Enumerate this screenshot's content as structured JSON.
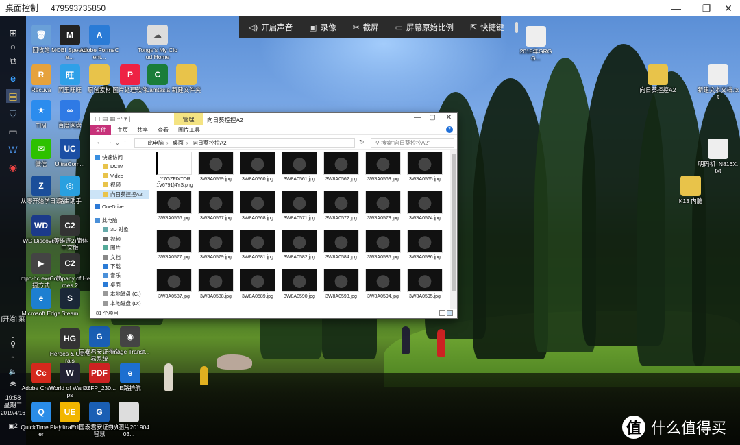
{
  "remote_window": {
    "title": "桌面控制",
    "remote_id": "479593735850",
    "controls": {
      "minimize": "—",
      "restore": "❐",
      "close": "✕"
    }
  },
  "toolbar": {
    "items": [
      {
        "label": "开启声音",
        "icon": "speaker-icon"
      },
      {
        "label": "录像",
        "icon": "record-icon"
      },
      {
        "label": "截屏",
        "icon": "scissors-icon"
      },
      {
        "label": "屏幕原始比例",
        "icon": "ratio-icon"
      },
      {
        "label": "快捷键",
        "icon": "shortcut-icon"
      }
    ]
  },
  "taskbar": {
    "start_label": "[开始] 菜",
    "ime": "英",
    "clock_time": "19:58",
    "clock_day": "星期二",
    "clock_date": "2019/4/16",
    "notification_count": "2"
  },
  "desktop_icons": [
    {
      "label": "回收站",
      "color": "#6aa0d8",
      "glyph": "🗑"
    },
    {
      "label": "MOBI Speedfre...",
      "color": "#222",
      "glyph": "M"
    },
    {
      "label": "Adobe FormsCent...",
      "color": "#2a7bd6",
      "glyph": "A"
    },
    {
      "label": "Tonge's My Cloud Home",
      "color": "#ddd",
      "glyph": "☁"
    },
    {
      "label": "Recuva",
      "color": "#e6a23c",
      "glyph": "R"
    },
    {
      "label": "阿里旺旺",
      "color": "#2fa0e8",
      "glyph": "旺"
    },
    {
      "label": "原创素材",
      "color": "#e8c34a",
      "glyph": ""
    },
    {
      "label": "图片处理软件",
      "color": "#e24",
      "glyph": "P"
    },
    {
      "label": "Camtasia",
      "color": "#1a7d3a",
      "glyph": "C"
    },
    {
      "label": "新建文件夹",
      "color": "#e8c34a",
      "glyph": ""
    },
    {
      "label": "TIM",
      "color": "#2b8cee",
      "glyph": "★"
    },
    {
      "label": "百度网盘",
      "color": "#2f7ae5",
      "glyph": "∞"
    },
    {
      "label": "微信",
      "color": "#2dc100",
      "glyph": "✉"
    },
    {
      "label": "UltraCom...",
      "color": "#1b4fa5",
      "glyph": "UC"
    },
    {
      "label": "从零开始学日语",
      "color": "#1a4e9a",
      "glyph": "Z"
    },
    {
      "label": "路由助手",
      "color": "#29a0e0",
      "glyph": "◎"
    },
    {
      "label": "WD Discovery",
      "color": "#1b3a8a",
      "glyph": "WD"
    },
    {
      "label": "(英雄连2)简体中文版",
      "color": "#333",
      "glyph": "C2"
    },
    {
      "label": "mpc-hc.exe - 快捷方式",
      "color": "#444",
      "glyph": "▶"
    },
    {
      "label": "Company of Heroes 2",
      "color": "#333",
      "glyph": "C2"
    },
    {
      "label": "Microsoft Edge",
      "color": "#1d7fd1",
      "glyph": "e"
    },
    {
      "label": "Steam",
      "color": "#1b2838",
      "glyph": "S"
    },
    {
      "label": "Heroes & Generals",
      "color": "#333",
      "glyph": "HG"
    },
    {
      "label": "国泰君安证券交易系统",
      "color": "#1a5fb4",
      "glyph": "G"
    },
    {
      "label": "Image Transf...",
      "color": "#444",
      "glyph": "◉"
    },
    {
      "label": "Adobe Creati...",
      "color": "#d4291c",
      "glyph": "Cc"
    },
    {
      "label": "World of Warships",
      "color": "#223",
      "glyph": "W"
    },
    {
      "label": "DZFP_230...",
      "color": "#c22",
      "glyph": "PDF"
    },
    {
      "label": "E路护航",
      "color": "#1d6fd0",
      "glyph": "e"
    },
    {
      "label": "QuickTime Player",
      "color": "#2a8de8",
      "glyph": "Q"
    },
    {
      "label": "UltraEdit",
      "color": "#f2b600",
      "glyph": "UE"
    },
    {
      "label": "国泰君安证券大智慧",
      "color": "#1a5fb4",
      "glyph": "G"
    },
    {
      "label": "TIM图片20190403...",
      "color": "#ddd",
      "glyph": ""
    },
    {
      "label": "2018年GRGG...",
      "color": "#eee",
      "glyph": ""
    },
    {
      "label": "向日葵控控A2",
      "color": "#e8c34a",
      "glyph": ""
    },
    {
      "label": "新建文本文档.txt",
      "color": "#eee",
      "glyph": ""
    },
    {
      "label": "明码机_N816X.txt",
      "color": "#eee",
      "glyph": ""
    },
    {
      "label": "K13 内脏",
      "color": "#e8c34a",
      "glyph": ""
    }
  ],
  "explorer": {
    "title": "向日葵控控A2",
    "manage_tab": "管理",
    "ribbon_tabs": [
      "文件",
      "主页",
      "共享",
      "查看",
      "图片工具"
    ],
    "breadcrumb": [
      "此电脑",
      "桌面",
      "向日葵控控A2"
    ],
    "search_placeholder": "搜索\"向日葵控控A2\"",
    "nav_items": [
      {
        "label": "快速访问",
        "kind": "star"
      },
      {
        "label": "DCIM",
        "kind": "folder"
      },
      {
        "label": "Video",
        "kind": "folder"
      },
      {
        "label": "视频",
        "kind": "folder"
      },
      {
        "label": "向日葵控控A2",
        "kind": "folder",
        "selected": true
      },
      {
        "label": "OneDrive",
        "kind": "cloud"
      },
      {
        "label": "此电脑",
        "kind": "pc"
      },
      {
        "label": "3D 对象",
        "kind": "obj"
      },
      {
        "label": "视频",
        "kind": "video"
      },
      {
        "label": "图片",
        "kind": "image"
      },
      {
        "label": "文档",
        "kind": "doc"
      },
      {
        "label": "下载",
        "kind": "download"
      },
      {
        "label": "音乐",
        "kind": "music"
      },
      {
        "label": "桌面",
        "kind": "desktop"
      },
      {
        "label": "本地磁盘 (C:)",
        "kind": "disk"
      },
      {
        "label": "本地磁盘 (D:)",
        "kind": "disk"
      }
    ],
    "files": [
      "_Y7GZFIXTOR I1V6791)4YS.png",
      "3W8A0559.jpg",
      "3W8A0560.jpg",
      "3W8A0561.jpg",
      "3W8A0562.jpg",
      "3W8A0563.jpg",
      "3W8A0565.jpg",
      "3W8A0566.jpg",
      "3W8A0567.jpg",
      "3W8A0568.jpg",
      "3W8A0571.jpg",
      "3W8A0572.jpg",
      "3W8A0573.jpg",
      "3W8A0574.jpg",
      "3W8A0577.jpg",
      "3W8A0579.jpg",
      "3W8A0581.jpg",
      "3W8A0582.jpg",
      "3W8A0584.jpg",
      "3W8A0585.jpg",
      "3W8A0586.jpg",
      "3W8A0587.jpg",
      "3W8A0588.jpg",
      "3W8A0589.jpg",
      "3W8A0590.jpg",
      "3W8A0593.jpg",
      "3W8A0594.jpg",
      "3W8A0595.jpg"
    ],
    "status": "81 个项目"
  },
  "watermark": {
    "logo": "值",
    "text": "什么值得买"
  }
}
